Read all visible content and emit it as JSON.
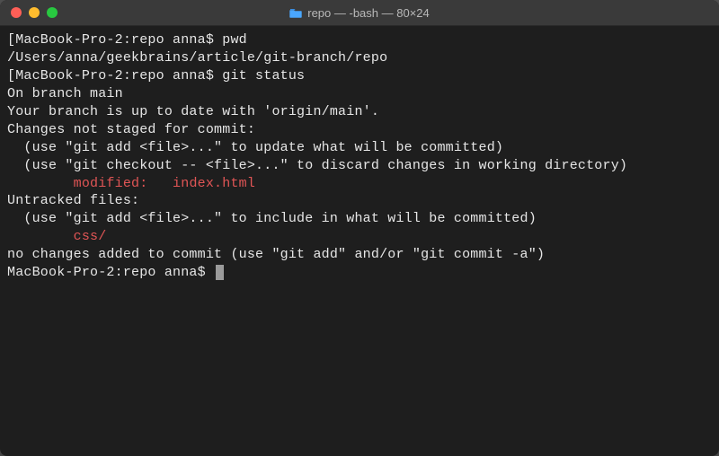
{
  "titlebar": {
    "icon": "folder-icon",
    "title": "repo — -bash — 80×24"
  },
  "window_controls": {
    "close": "close",
    "minimize": "minimize",
    "zoom": "zoom"
  },
  "colors": {
    "background": "#1e1e1e",
    "text": "#e6e6e6",
    "red": "#e05555",
    "titlebar": "#3a3a3a"
  },
  "terminal": {
    "lines": [
      {
        "segments": [
          {
            "t": "[MacBook-Pro-2:repo anna$ pwd"
          }
        ]
      },
      {
        "segments": [
          {
            "t": "/Users/anna/geekbrains/article/git-branch/repo"
          }
        ]
      },
      {
        "segments": [
          {
            "t": "[MacBook-Pro-2:repo anna$ git status"
          }
        ]
      },
      {
        "segments": [
          {
            "t": "On branch main"
          }
        ]
      },
      {
        "segments": [
          {
            "t": "Your branch is up to date with 'origin/main'."
          }
        ]
      },
      {
        "segments": [
          {
            "t": ""
          }
        ]
      },
      {
        "segments": [
          {
            "t": "Changes not staged for commit:"
          }
        ]
      },
      {
        "segments": [
          {
            "t": "  (use \"git add <file>...\" to update what will be committed)"
          }
        ]
      },
      {
        "segments": [
          {
            "t": "  (use \"git checkout -- <file>...\" to discard changes in working directory)"
          }
        ]
      },
      {
        "segments": [
          {
            "t": ""
          }
        ]
      },
      {
        "segments": [
          {
            "t": "        modified:   index.html",
            "cls": "red-text"
          }
        ]
      },
      {
        "segments": [
          {
            "t": ""
          }
        ]
      },
      {
        "segments": [
          {
            "t": "Untracked files:"
          }
        ]
      },
      {
        "segments": [
          {
            "t": "  (use \"git add <file>...\" to include in what will be committed)"
          }
        ]
      },
      {
        "segments": [
          {
            "t": ""
          }
        ]
      },
      {
        "segments": [
          {
            "t": "        css/",
            "cls": "red-text"
          }
        ]
      },
      {
        "segments": [
          {
            "t": ""
          }
        ]
      },
      {
        "segments": [
          {
            "t": "no changes added to commit (use \"git add\" and/or \"git commit -a\")"
          }
        ]
      },
      {
        "segments": [
          {
            "t": "MacBook-Pro-2:repo anna$ "
          }
        ],
        "cursor": true
      }
    ]
  }
}
